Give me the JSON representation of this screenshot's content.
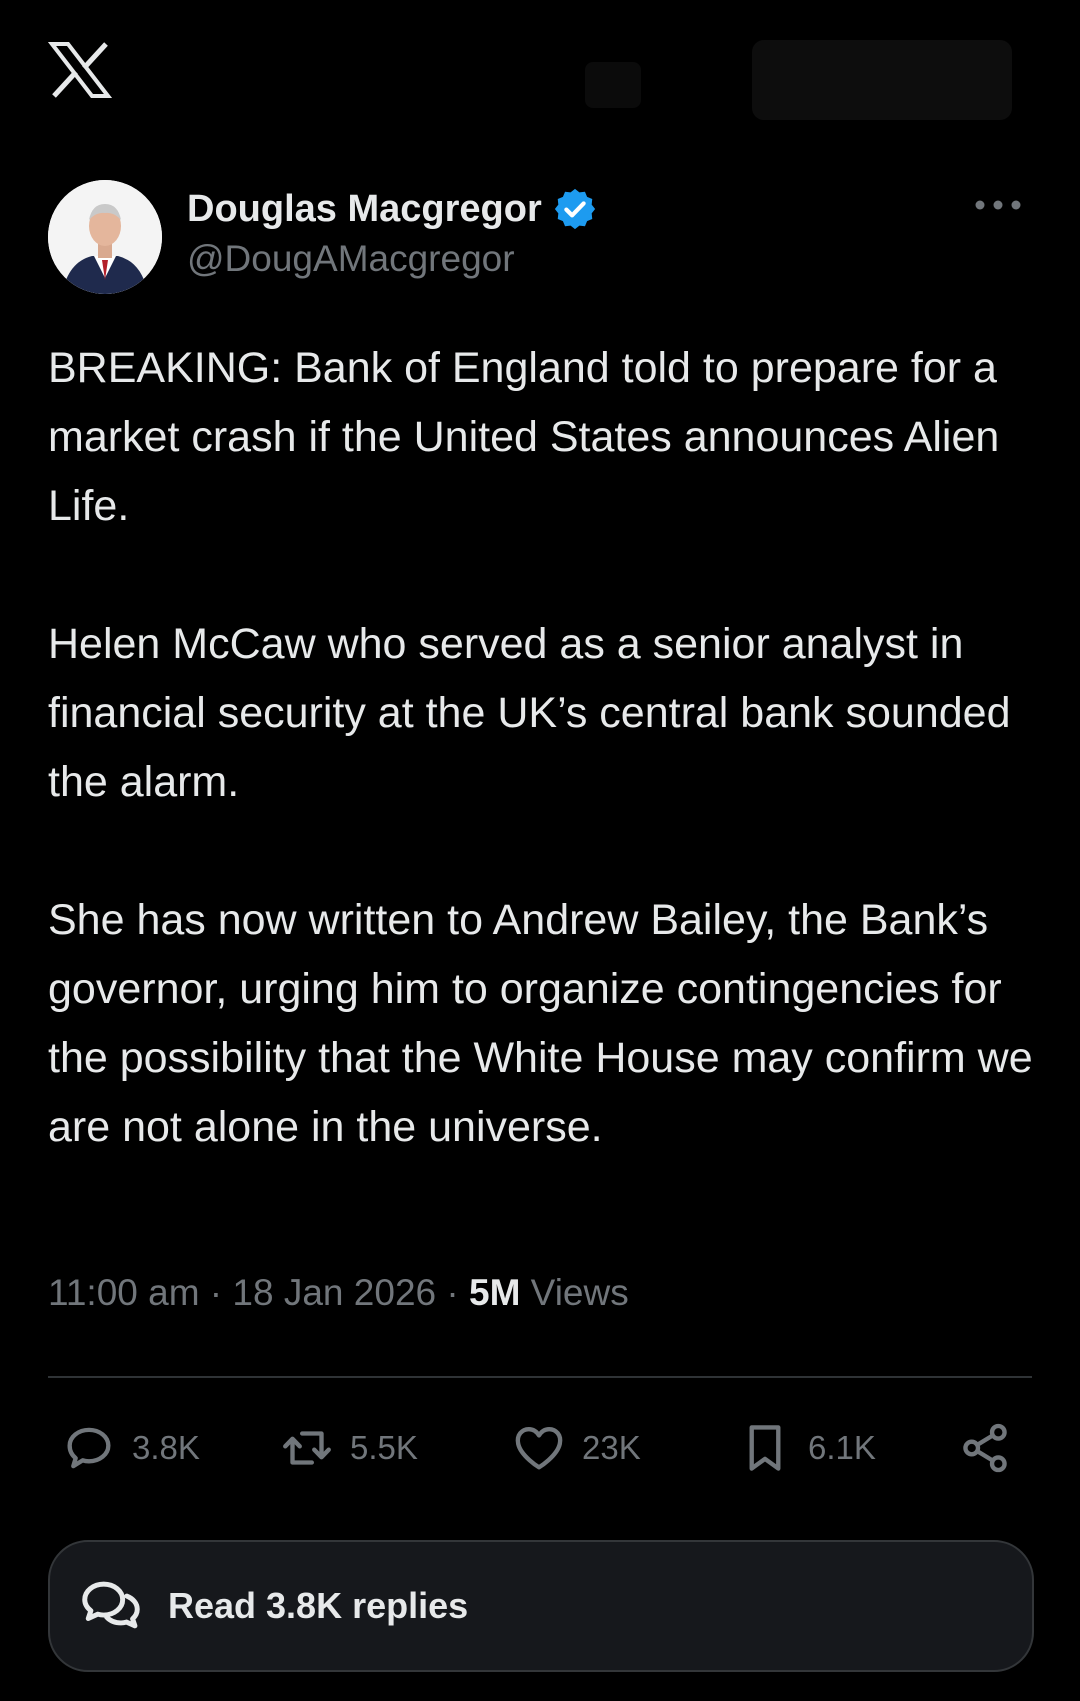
{
  "app": {
    "logo_icon": "x-logo-icon"
  },
  "author": {
    "display_name": "Douglas Macgregor",
    "handle": "@DougAMacgregor",
    "verified": true,
    "verified_color": "#1d9bf0"
  },
  "tweet": {
    "paragraphs": [
      "BREAKING: Bank of England told to prepare for a market crash if the United States announces Alien Life.",
      "Helen McCaw who served as a senior analyst in financial security at the UK’s central bank sounded the alarm.",
      "She has now written to Andrew Bailey, the Bank’s governor, urging him to organize contingencies for the possibility that the White House may confirm we are not alone in the universe."
    ],
    "time": "11:00 am",
    "separator": " · ",
    "date": "18 Jan 2026",
    "views_count": "5M",
    "views_label": " Views"
  },
  "actions": {
    "replies": "3.8K",
    "reposts": "5.5K",
    "likes": "23K",
    "bookmarks": "6.1K"
  },
  "read_replies_label": "Read 3.8K replies",
  "colors": {
    "background": "#000000",
    "text": "#e7e9ea",
    "secondary": "#71767b",
    "accent": "#1d9bf0"
  }
}
